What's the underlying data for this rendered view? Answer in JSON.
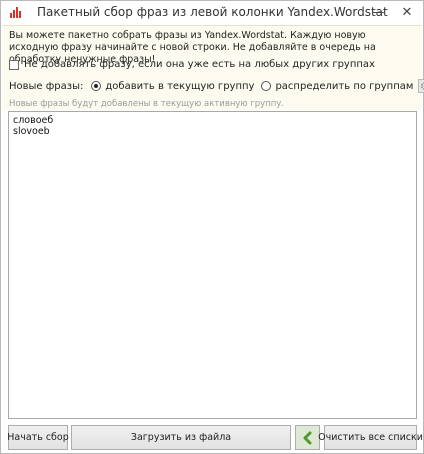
{
  "window": {
    "title": "Пакетный сбор фраз из левой колонки Yandex.Wordstat",
    "min_glyph": "—",
    "close_glyph": "✕",
    "icon": "bar-chart-icon",
    "accent_color": "#d9342b"
  },
  "info": {
    "description": "Вы можете пакетно собрать фразы из Yandex.Wordstat. Каждую новую исходную фразу начинайте с новой строки. Не добавляйте в очередь на обработку ненужные фразы!",
    "skip_existing_label": "Не добавлять фразу, если она уже есть на любых других группах",
    "skip_existing_checked": false,
    "new_phrases_label": "Новые фразы:",
    "options": [
      {
        "label": "добавить в текущую группу",
        "selected": true
      },
      {
        "label": "распределить по группам",
        "selected": false
      }
    ],
    "settings_icon": "gear-icon",
    "hint": "Новые фразы будут добавлены в текущую активную группу."
  },
  "phrases": [
    "словоеб",
    "slovoeb"
  ],
  "buttons": {
    "start": "Начать сбор",
    "load": "Загрузить из файла",
    "back_icon": "back-arrow-icon",
    "clear": "Очистить все списки"
  }
}
